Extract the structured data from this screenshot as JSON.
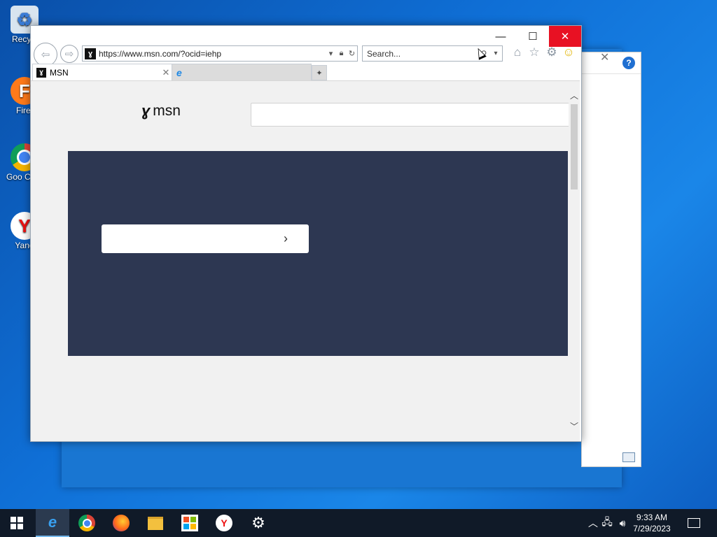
{
  "desktop": {
    "icons": [
      {
        "label": "Recycl",
        "icon": "recycle-bin-icon"
      },
      {
        "label": "Firef",
        "icon": "firefox-icon"
      },
      {
        "label": "Goo Chro",
        "icon": "chrome-icon"
      },
      {
        "label": "Yand",
        "icon": "yandex-icon"
      }
    ]
  },
  "browser": {
    "address": "https://www.msn.com/?ocid=iehp",
    "search_placeholder": "Search...",
    "tabs": [
      {
        "title": "MSN",
        "active": true
      },
      {
        "title": "",
        "active": false
      }
    ],
    "window_controls": {
      "minimize": "—",
      "maximize": "☐",
      "close": "✕"
    }
  },
  "page": {
    "logo_text": "msn",
    "banner_color": "#2d3752"
  },
  "taskbar": {
    "apps": [
      {
        "name": "internet-explorer",
        "active": true
      },
      {
        "name": "chrome",
        "active": false
      },
      {
        "name": "firefox",
        "active": false
      },
      {
        "name": "file-explorer",
        "active": false
      },
      {
        "name": "microsoft-store",
        "active": false
      },
      {
        "name": "yandex",
        "active": false
      },
      {
        "name": "settings",
        "active": false
      }
    ],
    "time": "9:33 AM",
    "date": "7/29/2023"
  },
  "colors": {
    "close_red": "#e81123",
    "taskbar": "#101a28",
    "desktop_blue": "#0f6fd6"
  }
}
